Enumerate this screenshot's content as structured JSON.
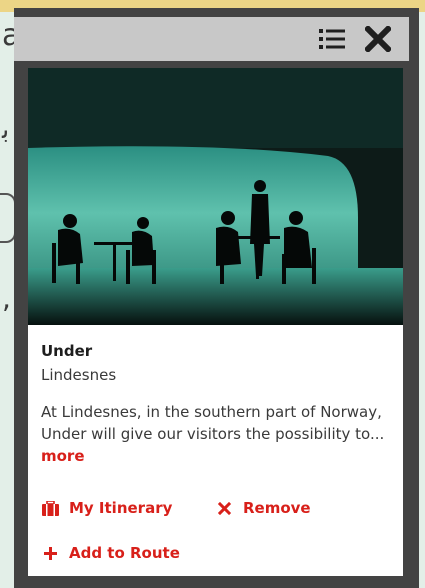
{
  "background": {
    "fragment_a": "a",
    "fragment_b": "ﺑ",
    "fragment_c": ","
  },
  "popup": {
    "header": {
      "list_icon": "list-icon",
      "close_icon": "close-icon"
    },
    "place": {
      "title": "Under",
      "location": "Lindesnes",
      "description": "At Lindesnes, in the southern part of Norway, Under will give our visitors the possibility to... ",
      "more_label": "more"
    },
    "actions": {
      "itinerary_label": "My Itinerary",
      "remove_label": "Remove",
      "add_route_label": "Add to Route"
    }
  },
  "colors": {
    "accent": "#d8201a",
    "header": "#c8c8c8",
    "frame": "#434343",
    "page_bg": "#e3efe8"
  }
}
